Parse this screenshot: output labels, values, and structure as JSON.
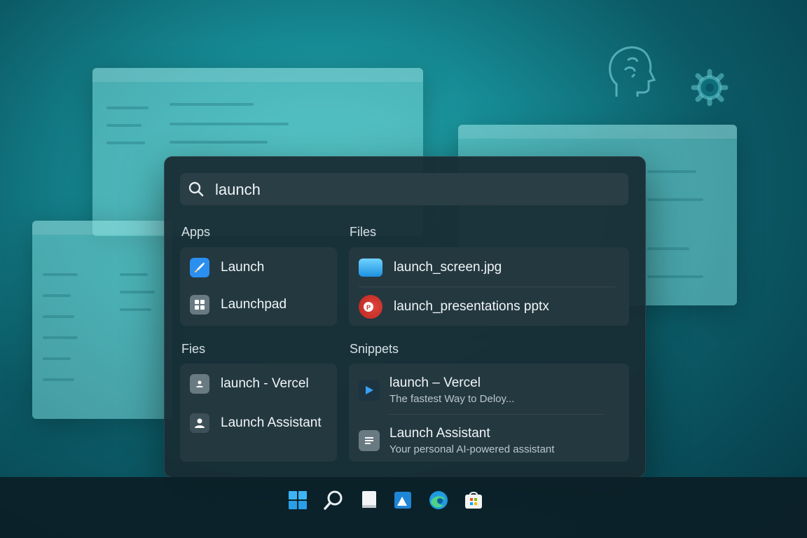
{
  "search": {
    "query": "launch"
  },
  "sections": {
    "apps_title": "Apps",
    "files_title": "Files",
    "fies_title": "Fies",
    "snippets_title": "Snippets"
  },
  "apps": [
    {
      "label": "Launch",
      "icon": "rocket-icon"
    },
    {
      "label": "Launchpad",
      "icon": "grid-icon"
    }
  ],
  "files": [
    {
      "label": "launch_screen.jpg",
      "icon": "image-file-icon"
    },
    {
      "label": "launch_presentations pptx",
      "icon": "powerpoint-icon"
    }
  ],
  "fies": [
    {
      "label": "launch - Vercel",
      "icon": "contact-icon"
    },
    {
      "label": "Launch Assistant",
      "icon": "person-icon"
    }
  ],
  "snippets": [
    {
      "title": "launch – Vercel",
      "subtitle": "The fastest Way to Deloy...",
      "icon": "vercel-play-icon"
    },
    {
      "title": "Launch Assistant",
      "subtitle": "Your personal AI-powered assistant",
      "icon": "document-icon"
    }
  ],
  "taskbar": [
    "windows-start-icon",
    "search-icon",
    "notepad-icon",
    "mail-icon",
    "edge-browser-icon",
    "store-icon"
  ],
  "colors": {
    "accent": "#2b8ff0",
    "panel": "#182c34",
    "card": "#243840",
    "background": "#168a93"
  }
}
